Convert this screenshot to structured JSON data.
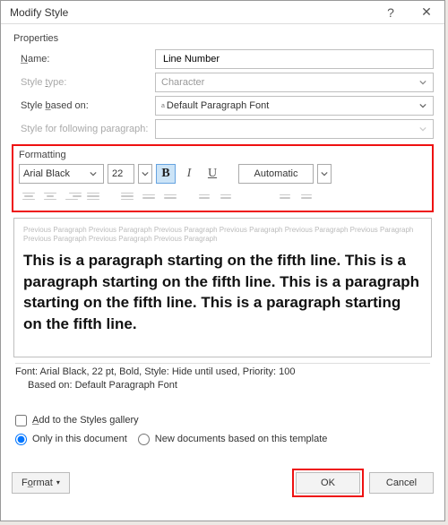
{
  "titlebar": {
    "title": "Modify Style"
  },
  "properties": {
    "section_label": "Properties",
    "name_label": "Name:",
    "name_value": "Line Number",
    "type_label": "Style type:",
    "type_value": "Character",
    "based_label": "Style based on:",
    "based_value": "Default Paragraph Font",
    "following_label": "Style for following paragraph:"
  },
  "formatting": {
    "section_label": "Formatting",
    "font_name": "Arial Black",
    "font_size": "22",
    "color_label": "Automatic"
  },
  "preview": {
    "ghost_text": "Previous Paragraph Previous Paragraph Previous Paragraph Previous Paragraph Previous Paragraph Previous Paragraph Previous Paragraph Previous Paragraph Previous Paragraph",
    "main_text": "This is a paragraph starting on the fifth line. This is a paragraph starting on the fifth line. This is a paragraph starting on the fifth line. This is a paragraph starting on the fifth line."
  },
  "description": {
    "line1": "Font: Arial Black, 22 pt, Bold, Style: Hide until used, Priority: 100",
    "line2": "Based on: Default Paragraph Font"
  },
  "options": {
    "add_gallery": "Add to the Styles gallery",
    "only_doc": "Only in this document",
    "new_docs": "New documents based on this template"
  },
  "footer": {
    "format_btn": "Format",
    "ok": "OK",
    "cancel": "Cancel"
  }
}
